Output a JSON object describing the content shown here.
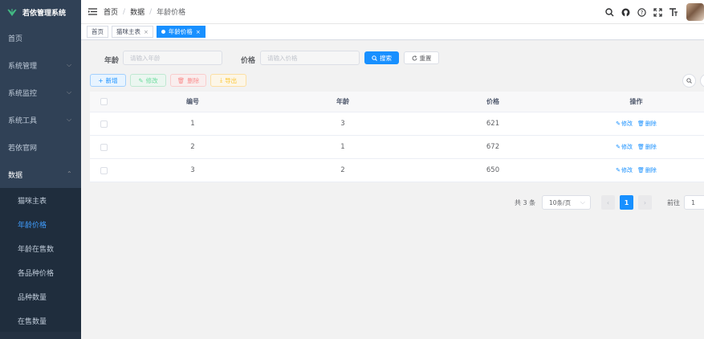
{
  "app": {
    "title": "若依管理系统"
  },
  "sidebar": {
    "items": [
      {
        "label": "首页"
      },
      {
        "label": "系统管理"
      },
      {
        "label": "系统监控"
      },
      {
        "label": "系统工具"
      },
      {
        "label": "若依官网"
      },
      {
        "label": "数据"
      }
    ],
    "subitems": [
      {
        "label": "猫咪主表"
      },
      {
        "label": "年龄价格"
      },
      {
        "label": "年龄在售数"
      },
      {
        "label": "各品种价格"
      },
      {
        "label": "品种数量"
      },
      {
        "label": "在售数量"
      }
    ]
  },
  "breadcrumb": [
    "首页",
    "数据",
    "年龄价格"
  ],
  "tags": [
    {
      "label": "首页"
    },
    {
      "label": "猫咪主表"
    },
    {
      "label": "年龄价格"
    }
  ],
  "search": {
    "age_label": "年龄",
    "age_placeholder": "请输入年龄",
    "price_label": "价格",
    "price_placeholder": "请输入价格",
    "search_btn": "搜索",
    "reset_btn": "重置"
  },
  "toolbar": {
    "add": "新增",
    "edit": "修改",
    "delete": "删除",
    "export": "导出"
  },
  "table": {
    "headers": {
      "id": "编号",
      "age": "年龄",
      "price": "价格",
      "op": "操作"
    },
    "rows": [
      {
        "id": "1",
        "age": "3",
        "price": "621"
      },
      {
        "id": "2",
        "age": "1",
        "price": "672"
      },
      {
        "id": "3",
        "age": "2",
        "price": "650"
      }
    ],
    "edit_label": "修改",
    "delete_label": "删除"
  },
  "pagination": {
    "total": "共 3 条",
    "page_size": "10条/页",
    "current": "1",
    "jump_label": "前往",
    "jump_value": "1"
  },
  "colors": {
    "primary": "#1890ff",
    "sidebar": "#304156",
    "active_menu": "#409eff"
  }
}
